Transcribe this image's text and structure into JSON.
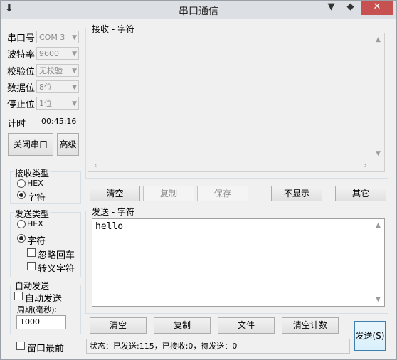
{
  "window": {
    "title": "串口通信",
    "min": "▼",
    "max": "◆",
    "close": "✕"
  },
  "settings": {
    "port_label": "串口号",
    "port_value": "COM 3",
    "baud_label": "波特率",
    "baud_value": "9600",
    "parity_label": "校验位",
    "parity_value": "无校验",
    "data_label": "数据位",
    "data_value": "8位",
    "stop_label": "停止位",
    "stop_value": "1位",
    "timer_label": "计时",
    "timer_value": "00:45:16",
    "close_port_label": "关闭串口",
    "advanced_label": "高级"
  },
  "receive_type": {
    "title": "接收类型",
    "hex": "HEX",
    "char": "字符",
    "selected": "char"
  },
  "send_type": {
    "title": "发送类型",
    "hex": "HEX",
    "char": "字符",
    "selected": "char",
    "ignore_cr": "忽略回车",
    "escape": "转义字符"
  },
  "auto_send": {
    "title": "自动发送",
    "checkbox_label": "自动发送",
    "period_label": "周期(毫秒):",
    "period_value": "1000"
  },
  "topmost_label": "窗口最前",
  "receive": {
    "title": "接收 - 字符",
    "clear": "清空",
    "copy": "复制",
    "save": "保存",
    "hide": "不显示",
    "other": "其它"
  },
  "send": {
    "title": "发送 - 字符",
    "text": "hello",
    "clear": "清空",
    "copy": "复制",
    "file": "文件",
    "clear_count": "清空计数",
    "send": "发送(S)"
  },
  "status": "状态：已发送:115，已接收:0，待发送：0"
}
